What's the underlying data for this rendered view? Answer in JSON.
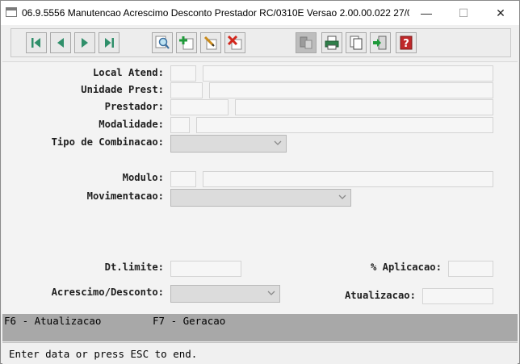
{
  "window": {
    "title": "06.9.5556 Manutencao  Acrescimo Desconto Prestador RC/0310E Versao 2.00.00.022 27/08...",
    "minimize": "—",
    "maximize": "☐",
    "close": "✕"
  },
  "toolbar": {
    "buttons": [
      {
        "name": "first-record",
        "icon": "first-icon"
      },
      {
        "name": "previous-record",
        "icon": "previous-icon"
      },
      {
        "name": "next-record",
        "icon": "next-icon"
      },
      {
        "name": "last-record",
        "icon": "last-icon"
      },
      {
        "name": "search",
        "icon": "magnifier-icon"
      },
      {
        "name": "add",
        "icon": "add-icon"
      },
      {
        "name": "edit",
        "icon": "edit-icon"
      },
      {
        "name": "delete",
        "icon": "delete-icon"
      },
      {
        "name": "filter",
        "icon": "filter-icon"
      },
      {
        "name": "print",
        "icon": "printer-icon"
      },
      {
        "name": "copy",
        "icon": "copy-icon"
      },
      {
        "name": "exit",
        "icon": "exit-icon"
      },
      {
        "name": "help",
        "icon": "help-icon"
      }
    ]
  },
  "form": {
    "local_atend_label": "Local Atend:",
    "unidade_prest_label": "Unidade Prest:",
    "prestador_label": "Prestador:",
    "modalidade_label": "Modalidade:",
    "tipo_combinacao_label": "Tipo de Combinacao:",
    "modulo_label": "Modulo:",
    "movimentacao_label": "Movimentacao:",
    "dt_limite_label": "Dt.limite:",
    "aplicacao_label": "% Aplicacao:",
    "acrescimo_desconto_label": "Acrescimo/Desconto:",
    "atualizacao_label": "Atualizacao:",
    "local_atend_code": "",
    "local_atend_desc": "",
    "unidade_prest_code": "",
    "unidade_prest_desc": "",
    "prestador_code": "",
    "prestador_desc": "",
    "modalidade_code": "",
    "modalidade_desc": "",
    "tipo_combinacao_value": "",
    "modulo_code": "",
    "modulo_desc": "",
    "movimentacao_value": "",
    "dt_limite_value": "",
    "aplicacao_value": "",
    "acrescimo_desconto_value": "",
    "atualizacao_value": ""
  },
  "function_keys": {
    "f6": "F6 - Atualizacao",
    "f7": "F7 - Geracao"
  },
  "status": {
    "message": "Enter data or press ESC to end."
  },
  "colors": {
    "function_bar": "#a8a8a8",
    "add_icon": "#1f9a3a",
    "delete_icon": "#d2281e",
    "help_icon": "#c0282a",
    "nav_icon": "#2f8f6a"
  }
}
